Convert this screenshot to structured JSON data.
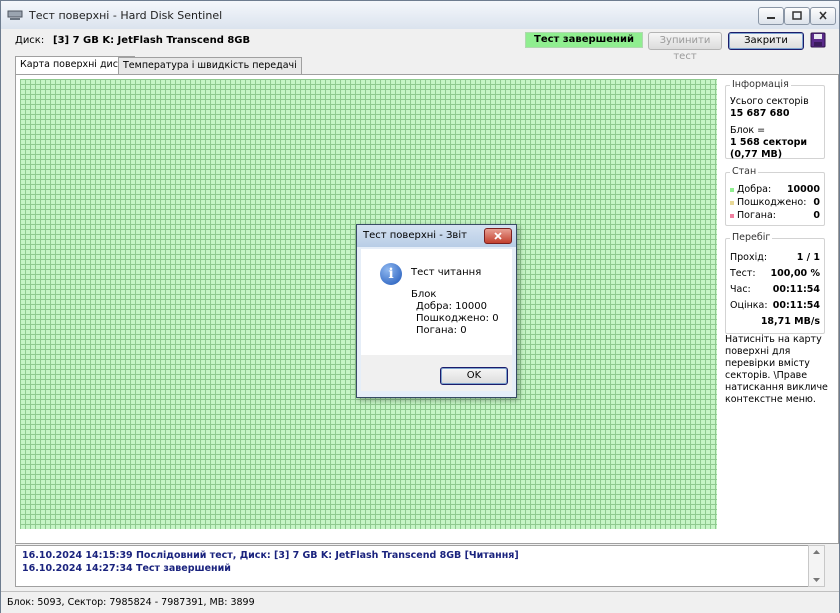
{
  "window": {
    "title": "Тест поверхні - Hard Disk Sentinel"
  },
  "toolbar": {
    "disk_label": "Диск:",
    "disk_value": "[3] 7 GB K: JetFlash Transcend 8GB",
    "status": "Тест завершений",
    "stop_label": "Зупинити тест",
    "close_label": "Закрити"
  },
  "tabs": [
    {
      "label": "Карта поверхні диска"
    },
    {
      "label": "Температура і швидкість передачі"
    }
  ],
  "info": {
    "title": "Інформація",
    "total_label": "Усього секторів",
    "total_value": "15 687 680",
    "block_label": "Блок =",
    "block_value": "1 568 сектори",
    "block_size": "(0,77 MB)"
  },
  "state": {
    "title": "Стан",
    "good_label": "Добра:",
    "good_value": "10000",
    "damaged_label": "Пошкоджено:",
    "damaged_value": "0",
    "bad_label": "Погана:",
    "bad_value": "0"
  },
  "progress": {
    "title": "Перебіг",
    "pass_label": "Прохід:",
    "pass_value": "1 / 1",
    "test_label": "Тест:",
    "test_value": "100,00 %",
    "time_label": "Час:",
    "time_value": "00:11:54",
    "estimate_label": "Оцінка:",
    "estimate_value": "00:11:54",
    "speed_value": "18,71 MB/s"
  },
  "hint": "Натисніть на карту поверхні для перевірки вмісту секторів. \\Праве натискання викличе контекстне меню.",
  "dialog": {
    "title": "Тест поверхні - Звіт",
    "heading": "Тест читання",
    "block_label": "Блок",
    "good": "Добра: 10000",
    "damaged": "Пошкоджено: 0",
    "bad": "Погана: 0",
    "ok_label": "OK"
  },
  "log": [
    "16.10.2024  14:15:39   Послідовний тест, Диск: [3] 7 GB K: JetFlash Transcend 8GB [Читання]",
    "16.10.2024  14:27:34   Тест завершений"
  ],
  "statusbar": {
    "text": "Блок: 5093, Сектор: 7985824 - 7987391, MB: 3899"
  },
  "colors": {
    "good": "#90ee90",
    "damaged": "#e8d896",
    "bad": "#f080a0",
    "log_text": "#1a237e"
  }
}
